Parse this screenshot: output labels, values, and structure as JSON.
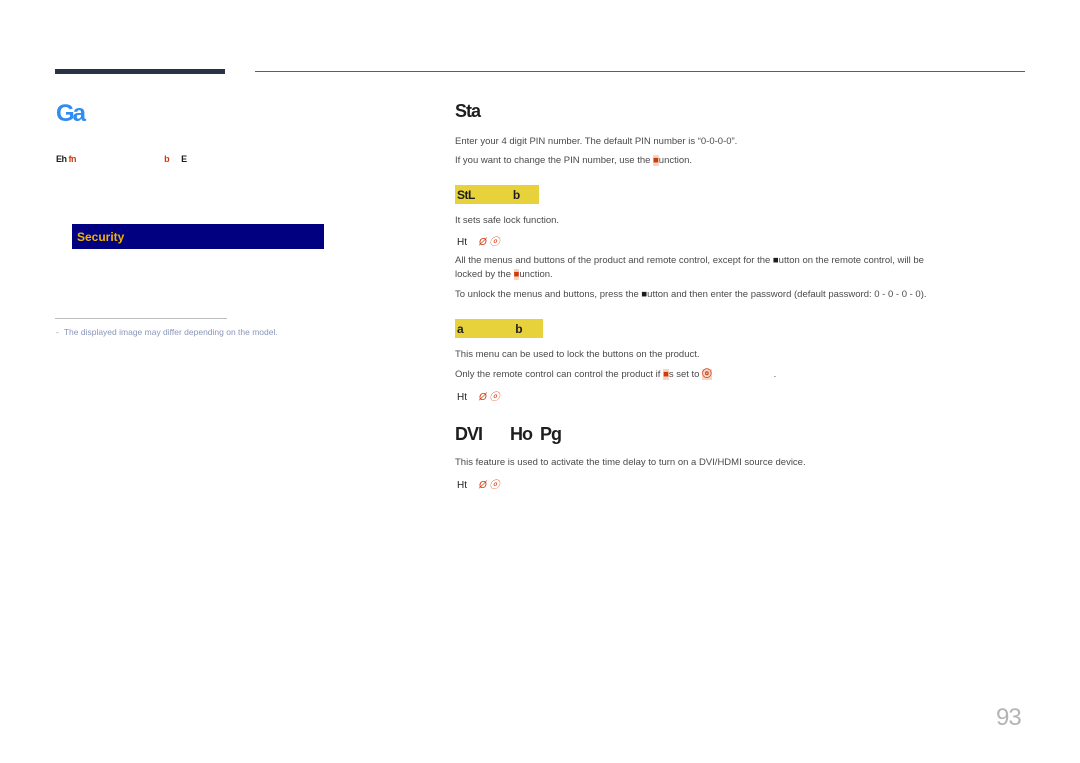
{
  "header": {
    "rule_color": "#2b3245"
  },
  "left_panel": {
    "title": "Ga",
    "menu_path": {
      "item1": "Eh",
      "item2": "fn",
      "item3": "b",
      "item4": "E"
    },
    "menu_highlight": "Security",
    "note_dash": "-",
    "note": "The displayed image may differ depending on the model."
  },
  "main": {
    "section1": {
      "title": "Sta",
      "p1": "Enter your 4 digit PIN number. The default PIN number is “0-0-0-0”.",
      "p2_before": "If you want to change the PIN number, use the ",
      "p2_glyph": "■",
      "p2_after": "unction."
    },
    "safe_lock": {
      "title": "StL",
      "title_suffix": "b",
      "desc": "It sets safe lock function.",
      "options_label": "Ht",
      "options_values": "Ø ⓞ",
      "p1_before": "All the menus and buttons of the product and remote control, except for the ",
      "p1_glyph": "■",
      "p1_after": "utton on the remote control, will be",
      "p1_line2_before": "locked by the ",
      "p1_line2_glyph": "■",
      "p1_line2_after": "unction.",
      "p2_before": "To unlock the menus and buttons, press the ",
      "p2_glyph": "■",
      "p2_after": "utton and then enter the password (default password: 0 - 0 - 0 - 0)."
    },
    "button_lock": {
      "title": "a",
      "title_suffix": "b",
      "desc": "This menu can be used to lock the buttons on the product.",
      "p1_before": "Only the remote control can control the product if ",
      "p1_glyph": "■",
      "p1_mid": "s set to ",
      "p1_glyph2": "ⓞ",
      "p1_end": ".",
      "options_label": "Ht",
      "options_values": "Ø ⓞ"
    },
    "section2": {
      "title": "DVI",
      "title_part2": "Ho",
      "title_part3": "Pg",
      "desc": "This feature is used to activate the time delay to turn on a DVI/HDMI source device.",
      "options_label": "Ht",
      "options_values": "Ø ⓞ"
    }
  },
  "footer": {
    "page_number": "93"
  }
}
